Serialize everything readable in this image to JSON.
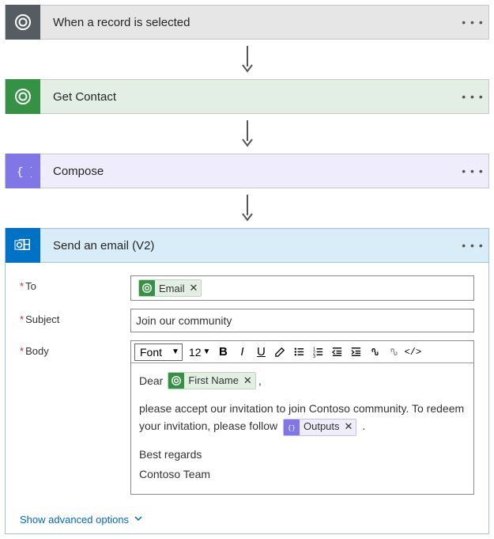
{
  "steps": {
    "trigger": {
      "title": "When a record is selected"
    },
    "getContact": {
      "title": "Get Contact"
    },
    "compose": {
      "title": "Compose"
    },
    "sendEmail": {
      "title": "Send an email (V2)"
    }
  },
  "email": {
    "labels": {
      "to": "To",
      "subject": "Subject",
      "body": "Body"
    },
    "tokens": {
      "email": "Email",
      "firstName": "First Name",
      "outputs": "Outputs"
    },
    "subject": "Join our community",
    "body": {
      "greeting": "Dear",
      "afterGreeting": ",",
      "para1a": "please accept our invitation to join Contoso community. To redeem your invitation, please follow",
      "para1b": ".",
      "sign1": "Best regards",
      "sign2": "Contoso Team"
    }
  },
  "toolbar": {
    "font": "Font",
    "size": "12"
  },
  "advanced": "Show advanced options"
}
